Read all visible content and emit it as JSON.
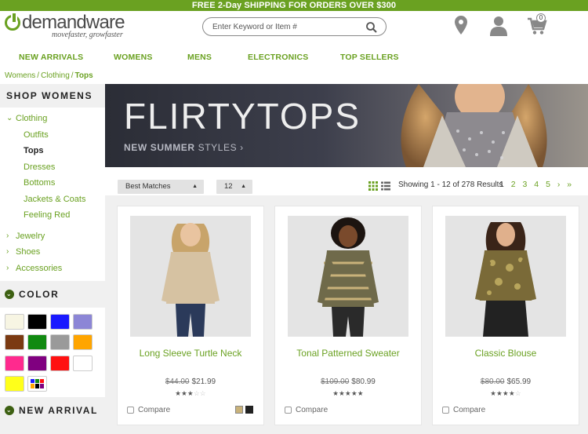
{
  "promo": {
    "bold_lead": "FREE 2-Day SHIPPING",
    "tail": " FOR ORDERS OVER $300"
  },
  "header": {
    "logo_text": "demandware",
    "logo_tagline": "movefaster, growfaster",
    "search_placeholder": "Enter Keyword or Item #",
    "cart_count": "0",
    "icons": [
      "location-pin-icon",
      "user-icon",
      "cart-icon",
      "search-icon"
    ]
  },
  "nav": [
    "NEW ARRIVALS",
    "WOMENS",
    "MENS",
    "ELECTRONICS",
    "TOP SELLERS"
  ],
  "breadcrumb": {
    "items": [
      "Womens",
      "Clothing"
    ],
    "current": "Tops",
    "separator": "/"
  },
  "sidebar": {
    "title": "SHOP WOMENS",
    "category": "Clothing",
    "subcategories": [
      "Outfits",
      "Tops",
      "Dresses",
      "Bottoms",
      "Jackets & Coats",
      "Feeling Red"
    ],
    "active_subcategory": "Tops",
    "other_categories": [
      "Jewelry",
      "Shoes",
      "Accessories"
    ],
    "color_heading": "COLOR",
    "new_arrival_heading": "NEW ARRIVAL",
    "swatch_colors": [
      "#f7f5e3",
      "#000000",
      "#1a1aff",
      "#8c86d6",
      "#7b3a12",
      "#118a11",
      "#9a9a9a",
      "#ffa500",
      "#ff2a8e",
      "#800080",
      "#ff1111",
      "#ffffff",
      "#ffff1a"
    ]
  },
  "banner": {
    "title": "FLIRTYTOPS",
    "sub_bold": "NEW SUMMER",
    "sub_light": " STYLES ›"
  },
  "toolbar": {
    "sort_label": "Best Matches",
    "per_page": "12",
    "results_text": "Showing 1 - 12 of 278 Results",
    "pages": [
      "1",
      "2",
      "3",
      "4",
      "5",
      "›",
      "»"
    ],
    "current_page": "1"
  },
  "products": [
    {
      "name": "Long Sleeve Turtle Neck",
      "old_price": "$44.00",
      "price": "$21.99",
      "rating": 2.5,
      "compare_label": "Compare",
      "swatches": [
        "#c9b27a",
        "#222222"
      ]
    },
    {
      "name": "Tonal Patterned Sweater",
      "old_price": "$109.00",
      "price": "$80.99",
      "rating": 4.5,
      "compare_label": "Compare",
      "swatches": []
    },
    {
      "name": "Classic Blouse",
      "old_price": "$80.00",
      "price": "$65.99",
      "rating": 3.5,
      "compare_label": "Compare",
      "swatches": []
    }
  ],
  "colors": {
    "brand_green": "#6aa121",
    "dark_green": "#3d6012",
    "panel_gray": "#f0f0f0"
  }
}
